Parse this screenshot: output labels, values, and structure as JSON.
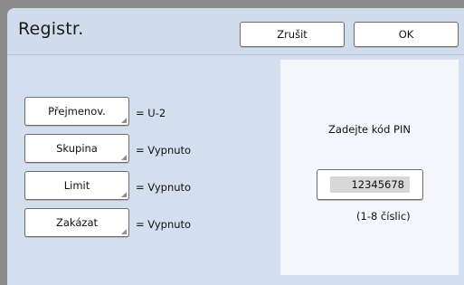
{
  "dialog": {
    "title": "Registr.",
    "cancel_label": "Zrušit",
    "ok_label": "OK"
  },
  "settings": [
    {
      "label": "Přejmenov.",
      "value": "= U-2"
    },
    {
      "label": "Skupina",
      "value": "= Vypnuto"
    },
    {
      "label": "Limit",
      "value": "= Vypnuto"
    },
    {
      "label": "Zakázat",
      "value": "= Vypnuto"
    }
  ],
  "pin": {
    "prompt": "Zadejte kód PIN",
    "value": "12345678",
    "hint": "(1-8 číslic)"
  },
  "colors": {
    "panel_background": "#d3dfee",
    "pin_panel_background": "#f4f6fb",
    "outer_frame": "#8c8c8c"
  }
}
